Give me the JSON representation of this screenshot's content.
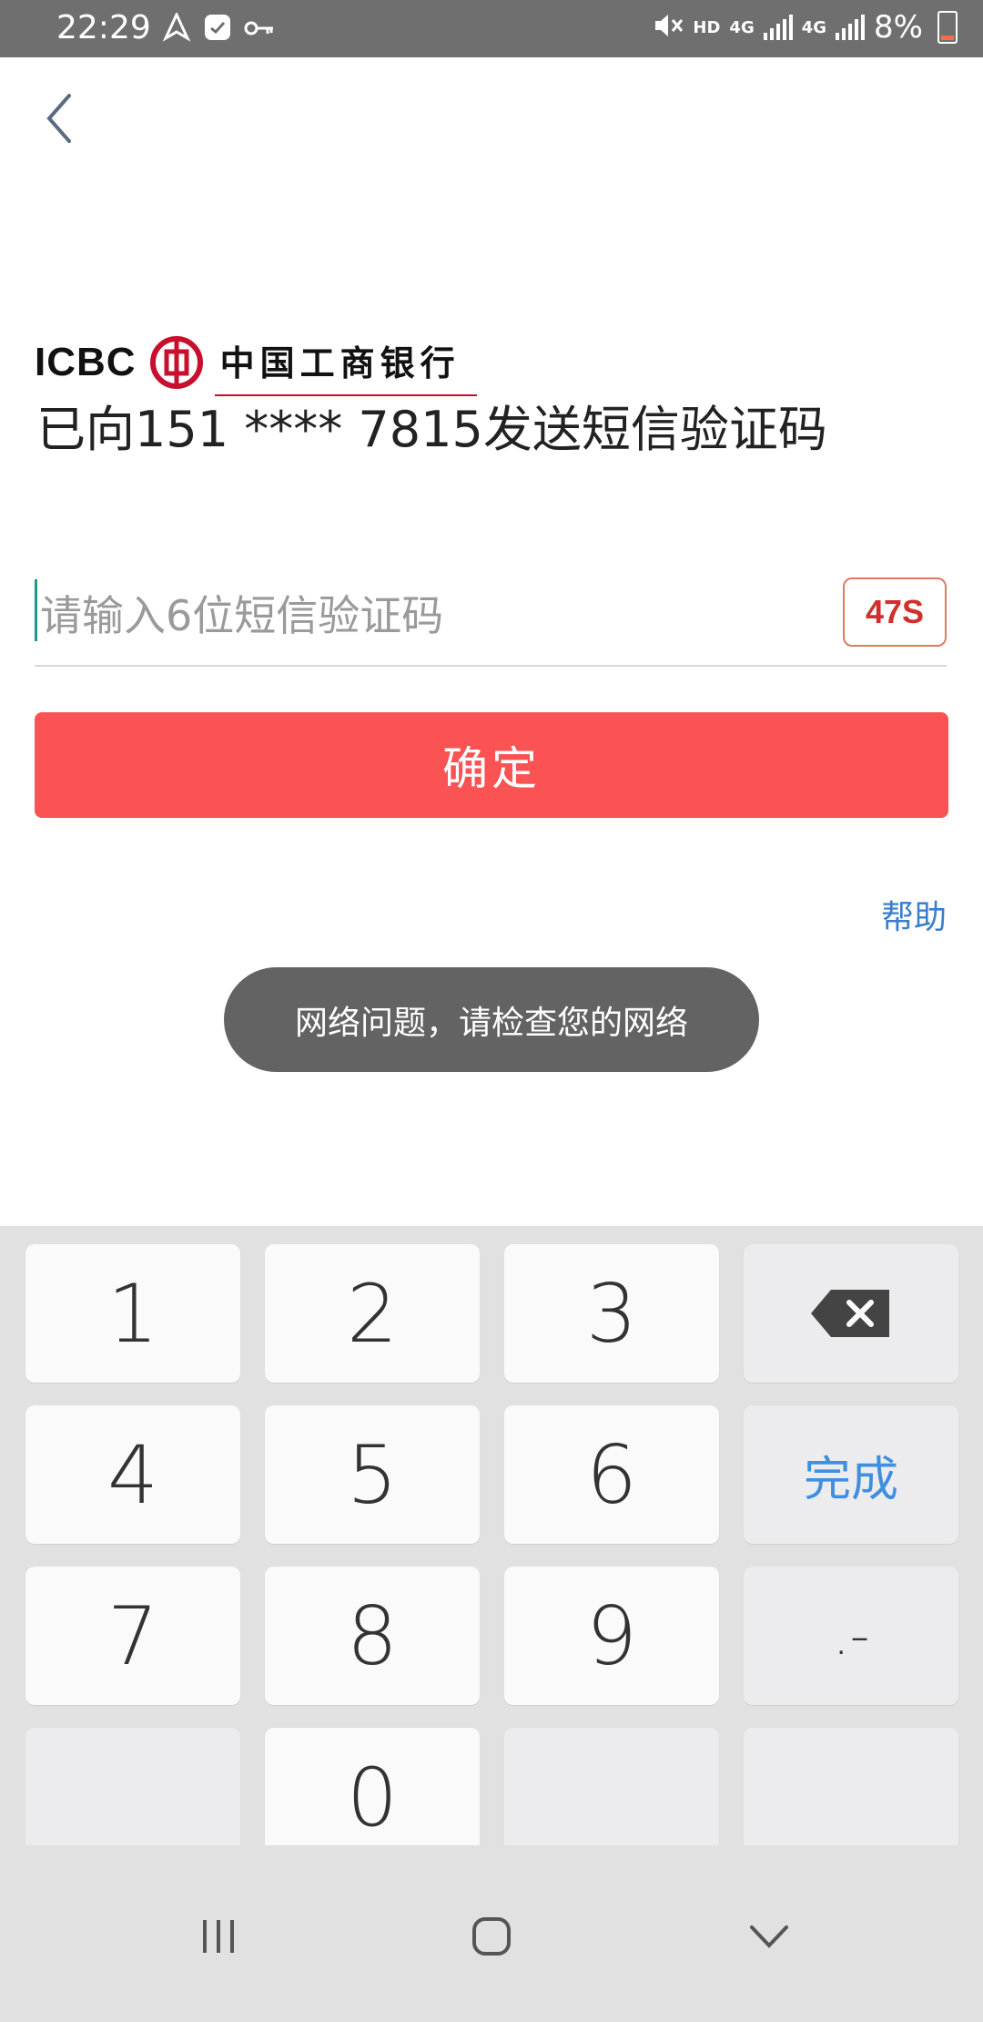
{
  "status_bar": {
    "time": "22:29",
    "hd": "HD",
    "net1": "4G",
    "net2": "4G",
    "battery": "8%"
  },
  "logo": {
    "en": "ICBC",
    "cn": "中国工商银行",
    "brand_color": "#c8102e"
  },
  "message": "已向151 **** 7815发送短信验证码",
  "code_input": {
    "placeholder": "请输入6位短信验证码",
    "value": ""
  },
  "countdown": "47S",
  "confirm_label": "确定",
  "help_label": "帮助",
  "toast": "网络问题，请检查您的网络",
  "keyboard": {
    "k1": "1",
    "k2": "2",
    "k3": "3",
    "k4": "4",
    "k5": "5",
    "k6": "6",
    "k7": "7",
    "k8": "8",
    "k9": "9",
    "k0": "0",
    "done": "完成",
    "dot": ".-"
  },
  "colors": {
    "accent": "#fb5253",
    "link": "#3b7dcc",
    "done": "#3f8fe0"
  }
}
